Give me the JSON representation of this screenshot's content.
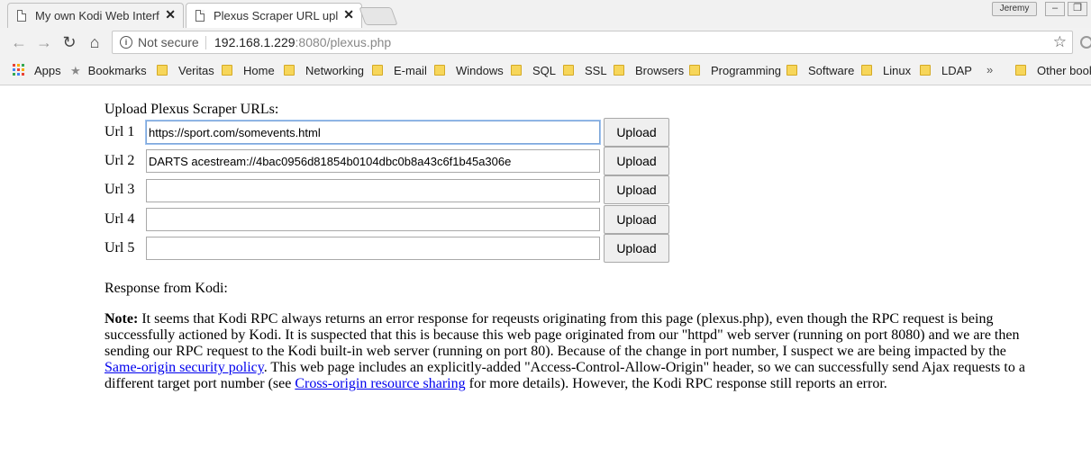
{
  "browser": {
    "tabs": [
      {
        "title": "My own Kodi Web Interfa",
        "close": "✕"
      },
      {
        "title": "Plexus Scraper URL uploa",
        "close": "✕"
      }
    ],
    "user": "Jeremy",
    "address": {
      "secure_label": "Not secure",
      "host": "192.168.1.229",
      "port_path": ":8080/plexus.php"
    },
    "bookmarks": {
      "apps": "Apps",
      "bookmarks": "Bookmarks",
      "folders": [
        "Veritas",
        "Home",
        "Networking",
        "E-mail",
        "Windows",
        "SQL",
        "SSL",
        "Browsers",
        "Programming",
        "Software",
        "Linux",
        "LDAP"
      ],
      "overflow": "»",
      "other": "Other bookm"
    },
    "icons": [
      "page-icon",
      "close-icon",
      "back-icon",
      "forward-icon",
      "reload-icon",
      "home-icon",
      "info-icon",
      "star-icon",
      "apps-icon",
      "bookmark-star-icon",
      "folder-icon",
      "minimize-icon",
      "restore-icon"
    ]
  },
  "page": {
    "heading": "Upload Plexus Scraper URLs:",
    "rows": [
      {
        "label": "Url 1",
        "value": "https://sport.com/somevents.html",
        "button": "Upload"
      },
      {
        "label": "Url 2",
        "value": "DARTS acestream://4bac0956d81854b0104dbc0b8a43c6f1b45a306e",
        "button": "Upload"
      },
      {
        "label": "Url 3",
        "value": "",
        "button": "Upload"
      },
      {
        "label": "Url 4",
        "value": "",
        "button": "Upload"
      },
      {
        "label": "Url 5",
        "value": "",
        "button": "Upload"
      }
    ],
    "response_label": "Response from Kodi:",
    "note": {
      "bold": "Note:",
      "part1": " It seems that Kodi RPC always returns an error response for reqeusts originating from this page (plexus.php), even though the RPC request is being successfully actioned by Kodi. It is suspected that this is because this web page originated from our \"httpd\" web server (running on port 8080) and we are then sending our RPC request to the Kodi built-in web server (running on port 80). Because of the change in port number, I suspect we are being impacted by the ",
      "link1": "Same-origin security policy",
      "part2": ". This web page includes an explicitly-added \"Access-Control-Allow-Origin\" header, so we can successfully send Ajax requests to a different target port number (see ",
      "link2": "Cross-origin resource sharing",
      "part3": " for more details). However, the Kodi RPC response still reports an error."
    }
  }
}
